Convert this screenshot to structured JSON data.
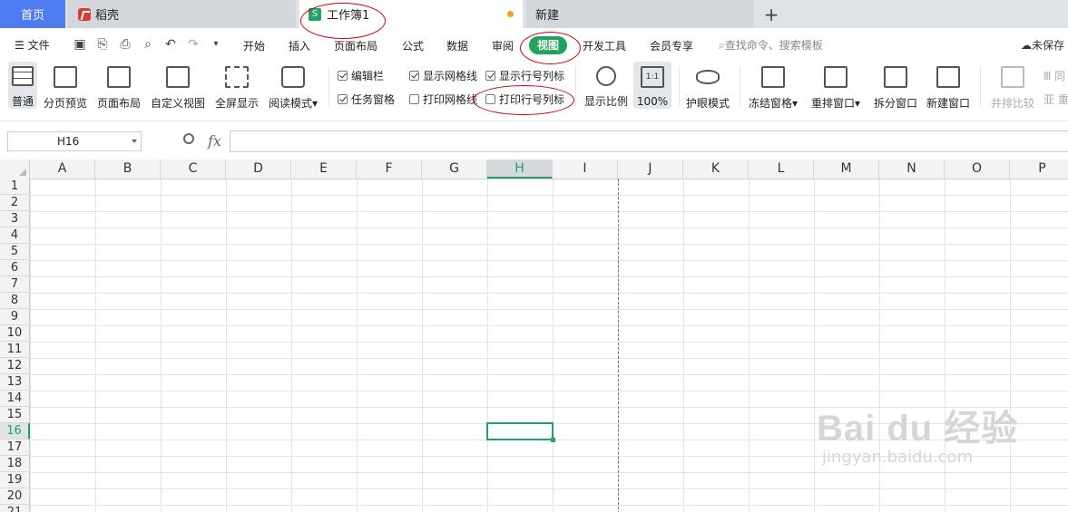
{
  "tabs": {
    "home": "首页",
    "daoke": "稻壳",
    "workbook": "工作簿1",
    "new": "新建",
    "add": "+"
  },
  "menu": {
    "file": "文件",
    "items": [
      "开始",
      "插入",
      "页面布局",
      "公式",
      "数据",
      "审阅",
      "视图",
      "开发工具",
      "会员专享"
    ],
    "search_placeholder": "查找命令、搜索模板",
    "unsaved": "未保存"
  },
  "ribbon": {
    "normal": "普通",
    "page_break_preview": "分页预览",
    "page_layout": "页面布局",
    "custom_view": "自定义视图",
    "fullscreen": "全屏显示",
    "reading_mode": "阅读模式",
    "checks": {
      "edit_bar": {
        "label": "编辑栏",
        "checked": true
      },
      "task_pane": {
        "label": "任务窗格",
        "checked": true
      },
      "show_gridlines": {
        "label": "显示网格线",
        "checked": true
      },
      "print_gridlines": {
        "label": "打印网格线",
        "checked": false
      },
      "show_headers": {
        "label": "显示行号列标",
        "checked": true
      },
      "print_headers": {
        "label": "打印行号列标",
        "checked": false
      }
    },
    "zoom": "显示比例",
    "zoom_100": "100%",
    "eye_mode": "护眼模式",
    "freeze": "冻结窗格",
    "arrange": "重排窗口",
    "split": "拆分窗口",
    "new_window": "新建窗口",
    "compare": "并排比较"
  },
  "formula_bar": {
    "name_box": "H16",
    "fx": "fx",
    "formula": ""
  },
  "sheet": {
    "columns": [
      "A",
      "B",
      "C",
      "D",
      "E",
      "F",
      "G",
      "H",
      "I",
      "J",
      "K",
      "L",
      "M",
      "N",
      "O",
      "P"
    ],
    "rows": [
      "1",
      "2",
      "3",
      "4",
      "5",
      "6",
      "7",
      "8",
      "9",
      "10",
      "11",
      "12",
      "13",
      "14",
      "15",
      "16",
      "17",
      "18",
      "19",
      "20",
      "21"
    ],
    "selected_cell": "H16"
  },
  "watermark": {
    "logo": "Bai du 经验",
    "url": "jingyan.baidu.com"
  },
  "colors": {
    "accent": "#21a366",
    "home_tab": "#4e7cf0",
    "annotation": "#cc0000"
  }
}
